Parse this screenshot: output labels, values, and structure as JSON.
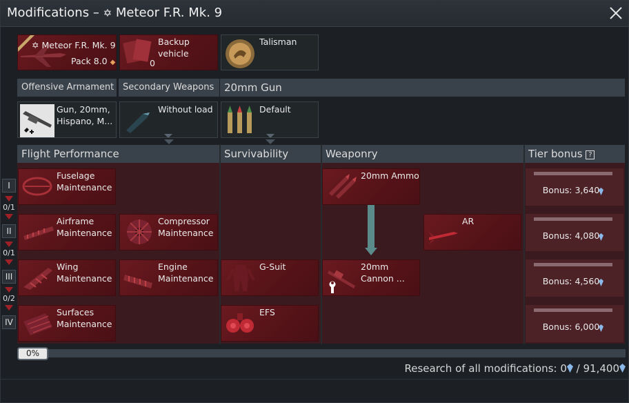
{
  "window": {
    "title_prefix": "Modifications –",
    "title_vehicle": "Meteor F.R. Mk. 9"
  },
  "top_slots": {
    "vehicle": {
      "name": "Meteor F.R. Mk. 9",
      "pack": "Pack 8.0"
    },
    "backup": {
      "label_line1": "Backup",
      "label_line2": "vehicle",
      "count": "0"
    },
    "talisman": {
      "label": "Talisman"
    }
  },
  "weapon_headers": {
    "offensive": "Offensive Armament",
    "secondary": "Secondary Weapons",
    "gun": "20mm Gun"
  },
  "weapon_slots": {
    "offensive": {
      "line1": "Gun, 20mm,",
      "line2": "Hispano, M..."
    },
    "secondary": {
      "label": "Without load"
    },
    "gun": {
      "label": "Default"
    }
  },
  "module_headers": {
    "flight": "Flight Performance",
    "survivability": "Survivability",
    "weaponry": "Weaponry",
    "tier_bonus": "Tier bonus"
  },
  "tiers": {
    "labels": [
      "I",
      "II",
      "III",
      "IV"
    ],
    "counts": [
      "0/1",
      "0/1",
      "0/2"
    ]
  },
  "modules": {
    "fuselage": {
      "line1": "Fuselage",
      "line2": "Maintenance"
    },
    "airframe": {
      "line1": "Airframe",
      "line2": "Maintenance"
    },
    "compressor": {
      "line1": "Compressor",
      "line2": "Maintenance"
    },
    "wing": {
      "line1": "Wing",
      "line2": "Maintenance"
    },
    "engine": {
      "line1": "Engine",
      "line2": "Maintenance"
    },
    "surfaces": {
      "line1": "Surfaces",
      "line2": "Maintenance"
    },
    "gsuit": {
      "label": "G-Suit"
    },
    "efs": {
      "label": "EFS"
    },
    "ammo": {
      "label": "20mm Ammo"
    },
    "ar": {
      "label": "AR"
    },
    "cannon": {
      "line1": "20mm",
      "line2": "Cannon ..."
    }
  },
  "bonuses": [
    "Bonus: 3,640",
    "Bonus: 4,080",
    "Bonus: 4,560",
    "Bonus: 6,000"
  ],
  "progress": {
    "label": "0%",
    "value": 0
  },
  "research": {
    "label": "Research of all modifications: 0",
    "separator": "/",
    "total": "91,400"
  },
  "colors": {
    "accent_red": "#6a1a20",
    "research_gem": "#8ab8e8",
    "header_bg": "#39414a"
  },
  "icons": [
    "close-icon",
    "country-star-icon",
    "premium-diamond-icon",
    "research-gem-icon",
    "wrench-icon",
    "help-icon"
  ]
}
